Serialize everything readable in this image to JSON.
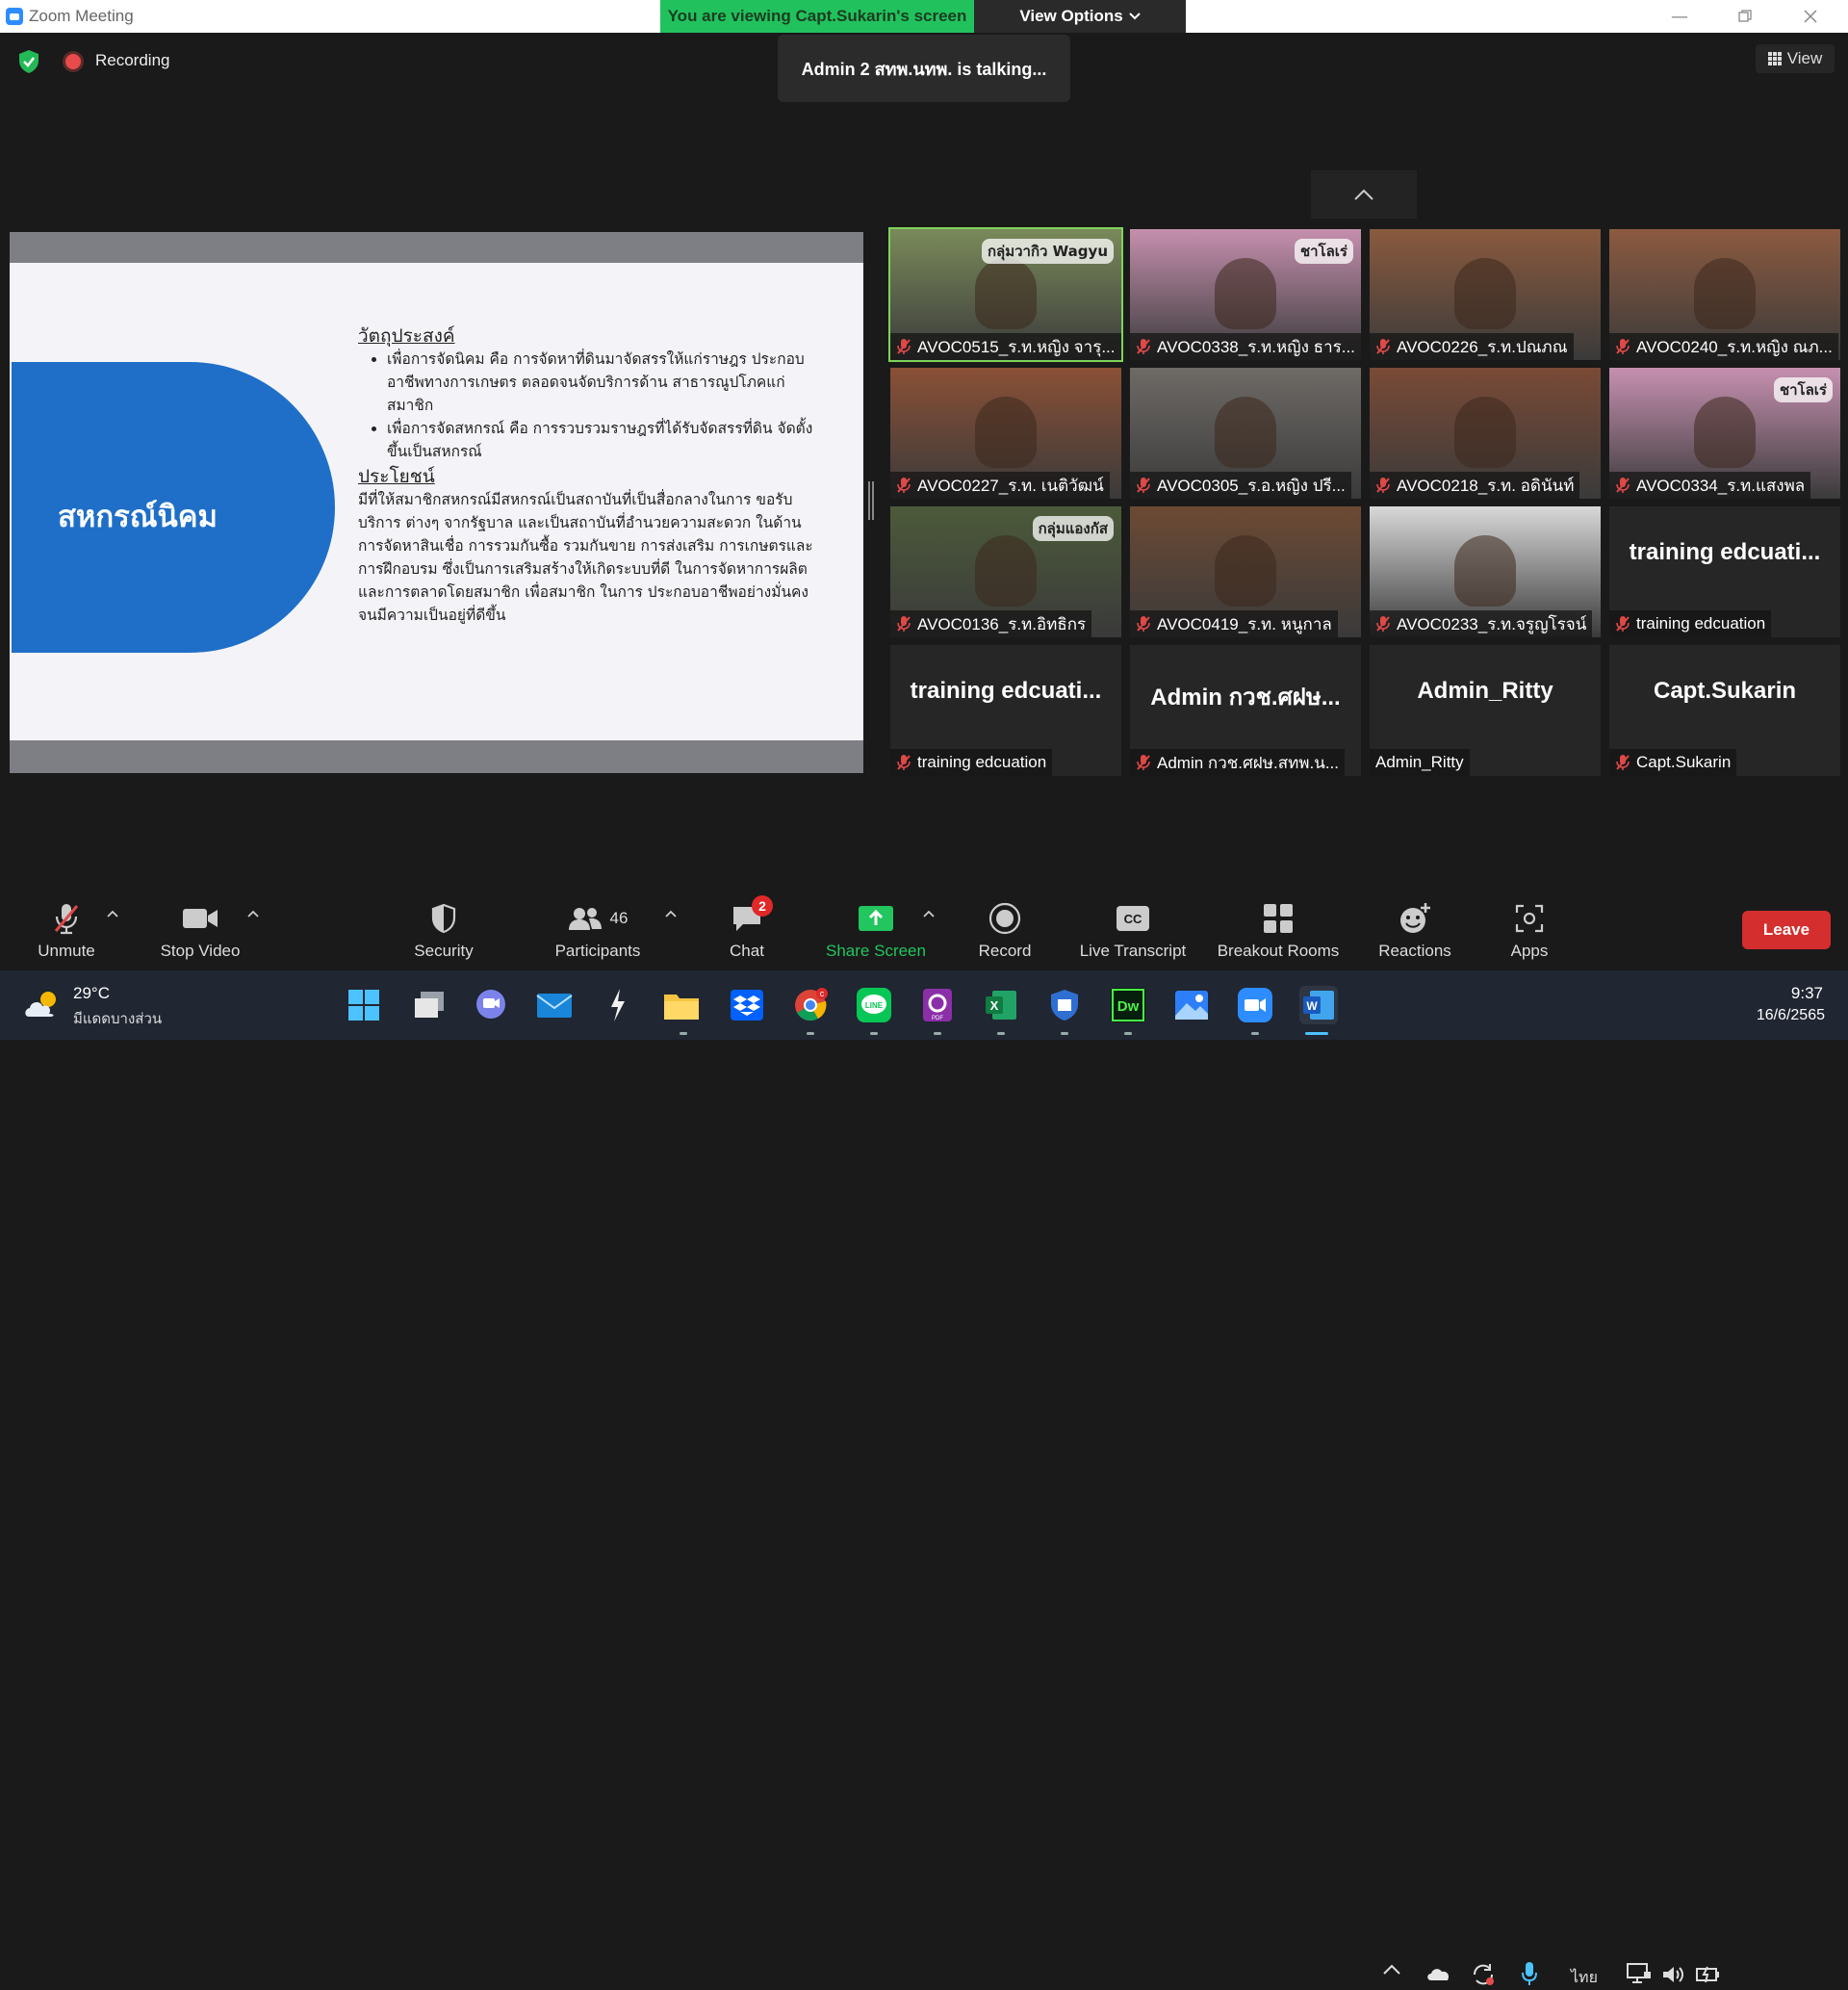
{
  "window": {
    "title": "Zoom Meeting",
    "share_banner": "You are viewing Capt.Sukarin's screen",
    "view_options": "View Options"
  },
  "meeting": {
    "recording_label": "Recording",
    "talking": "Admin 2 สทพ.นทพ. is talking...",
    "view_label": "View"
  },
  "slide": {
    "title": "สหกรณ์นิคม",
    "heading1": "วัตถุประสงค์",
    "bullets": [
      "เพื่อการจัดนิคม คือ การจัดหาที่ดินมาจัดสรรให้แก่ราษฎร ประกอบอาชีพทางการเกษตร ตลอดจนจัดบริการด้าน สาธารณูปโภคแก่สมาชิก",
      "เพื่อการจัดสหกรณ์ คือ การรวบรวมราษฎรที่ได้รับจัดสรรที่ดิน จัดตั้งขึ้นเป็นสหกรณ์"
    ],
    "heading2": "ประโยชน์",
    "paragraph": "มีที่ให้สมาชิกสหกรณ์มีสหกรณ์เป็นสถาบันที่เป็นสื่อกลางในการ ขอรับบริการ ต่างๆ จากรัฐบาล และเป็นสถาบันที่อำนวยความสะดวก ในด้านการจัดหาสินเชื่อ การรวมกันซื้อ รวมกันขาย การส่งเสริม การเกษตรและการฝึกอบรม ซึ่งเป็นการเสริมสร้างให้เกิดระบบที่ดี ในการจัดหาการผลิต และการตลาดโดยสมาชิก เพื่อสมาชิก ในการ ประกอบอาชีพอย่างมั่นคงจนมีความเป็นอยู่ที่ดีขึ้น"
  },
  "participants_grid": [
    {
      "name": "AVOC0515_ร.ท.หญิง จารุ...",
      "overlay": "กลุ่มวากิว Wagyu",
      "muted": true,
      "bg": "#7a8a5a"
    },
    {
      "name": "AVOC0338_ร.ท.หญิง ธาร...",
      "overlay": "ชาโลเร่",
      "muted": true,
      "bg": "#c58fae"
    },
    {
      "name": "AVOC0226_ร.ท.ปณภณ",
      "overlay": "",
      "muted": true,
      "bg": "#8a5a3e"
    },
    {
      "name": "AVOC0240_ร.ท.หญิง ณภ...",
      "overlay": "",
      "muted": true,
      "bg": "#8c5a40"
    },
    {
      "name": "AVOC0227_ร.ท. เนติวัฒน์",
      "overlay": "",
      "muted": true,
      "bg": "#8a5036"
    },
    {
      "name": "AVOC0305_ร.อ.หญิง ปรี...",
      "overlay": "",
      "muted": true,
      "bg": "#6e6a66"
    },
    {
      "name": "AVOC0218_ร.ท. อดินันท์",
      "overlay": "",
      "muted": true,
      "bg": "#7a4a36"
    },
    {
      "name": "AVOC0334_ร.ท.แสงพล",
      "overlay": "ชาโลเร่",
      "muted": true,
      "bg": "#c690b0"
    },
    {
      "name": "AVOC0136_ร.ท.อิทธิกร",
      "overlay": "กลุ่มแองกัส",
      "muted": true,
      "bg": "#4c5a3a"
    },
    {
      "name": "AVOC0419_ร.ท. หนูกาล",
      "overlay": "",
      "muted": true,
      "bg": "#6c4a34"
    },
    {
      "name": "AVOC0233_ร.ท.จรูญโรจน์",
      "overlay": "",
      "muted": true,
      "bg": "#d8d8d8"
    },
    {
      "name": "training edcuation",
      "big": "training edcuati...",
      "muted": true
    },
    {
      "name": "training edcuation",
      "big": "training edcuati...",
      "muted": true
    },
    {
      "name": "Admin กวช.ศฝษ.สทพ.น...",
      "big": "Admin กวช.ศฝษ...",
      "muted": true
    },
    {
      "name": "Admin_Ritty",
      "big": "Admin_Ritty",
      "muted": false
    },
    {
      "name": "Capt.Sukarin",
      "big": "Capt.Sukarin",
      "muted": true
    }
  ],
  "toolbar": {
    "unmute": "Unmute",
    "stop_video": "Stop Video",
    "security": "Security",
    "participants": "Participants",
    "participants_count": "46",
    "chat": "Chat",
    "chat_badge": "2",
    "share_screen": "Share Screen",
    "record": "Record",
    "live_transcript": "Live Transcript",
    "breakout_rooms": "Breakout Rooms",
    "reactions": "Reactions",
    "apps": "Apps",
    "leave": "Leave",
    "cc_text": "CC"
  },
  "taskbar": {
    "temp": "29°C",
    "weather": "มีแดดบางส่วน",
    "lang": "ไทย",
    "time": "9:37",
    "date": "16/6/2565",
    "dw_label": "Dw",
    "excel_label": "X",
    "word_label": "W",
    "chrome_badge": "c"
  },
  "colors": {
    "share_green": "#21c25e",
    "leave_red": "#d42e2e",
    "slide_blue": "#1f6fc8",
    "mic_red": "#e04848"
  }
}
